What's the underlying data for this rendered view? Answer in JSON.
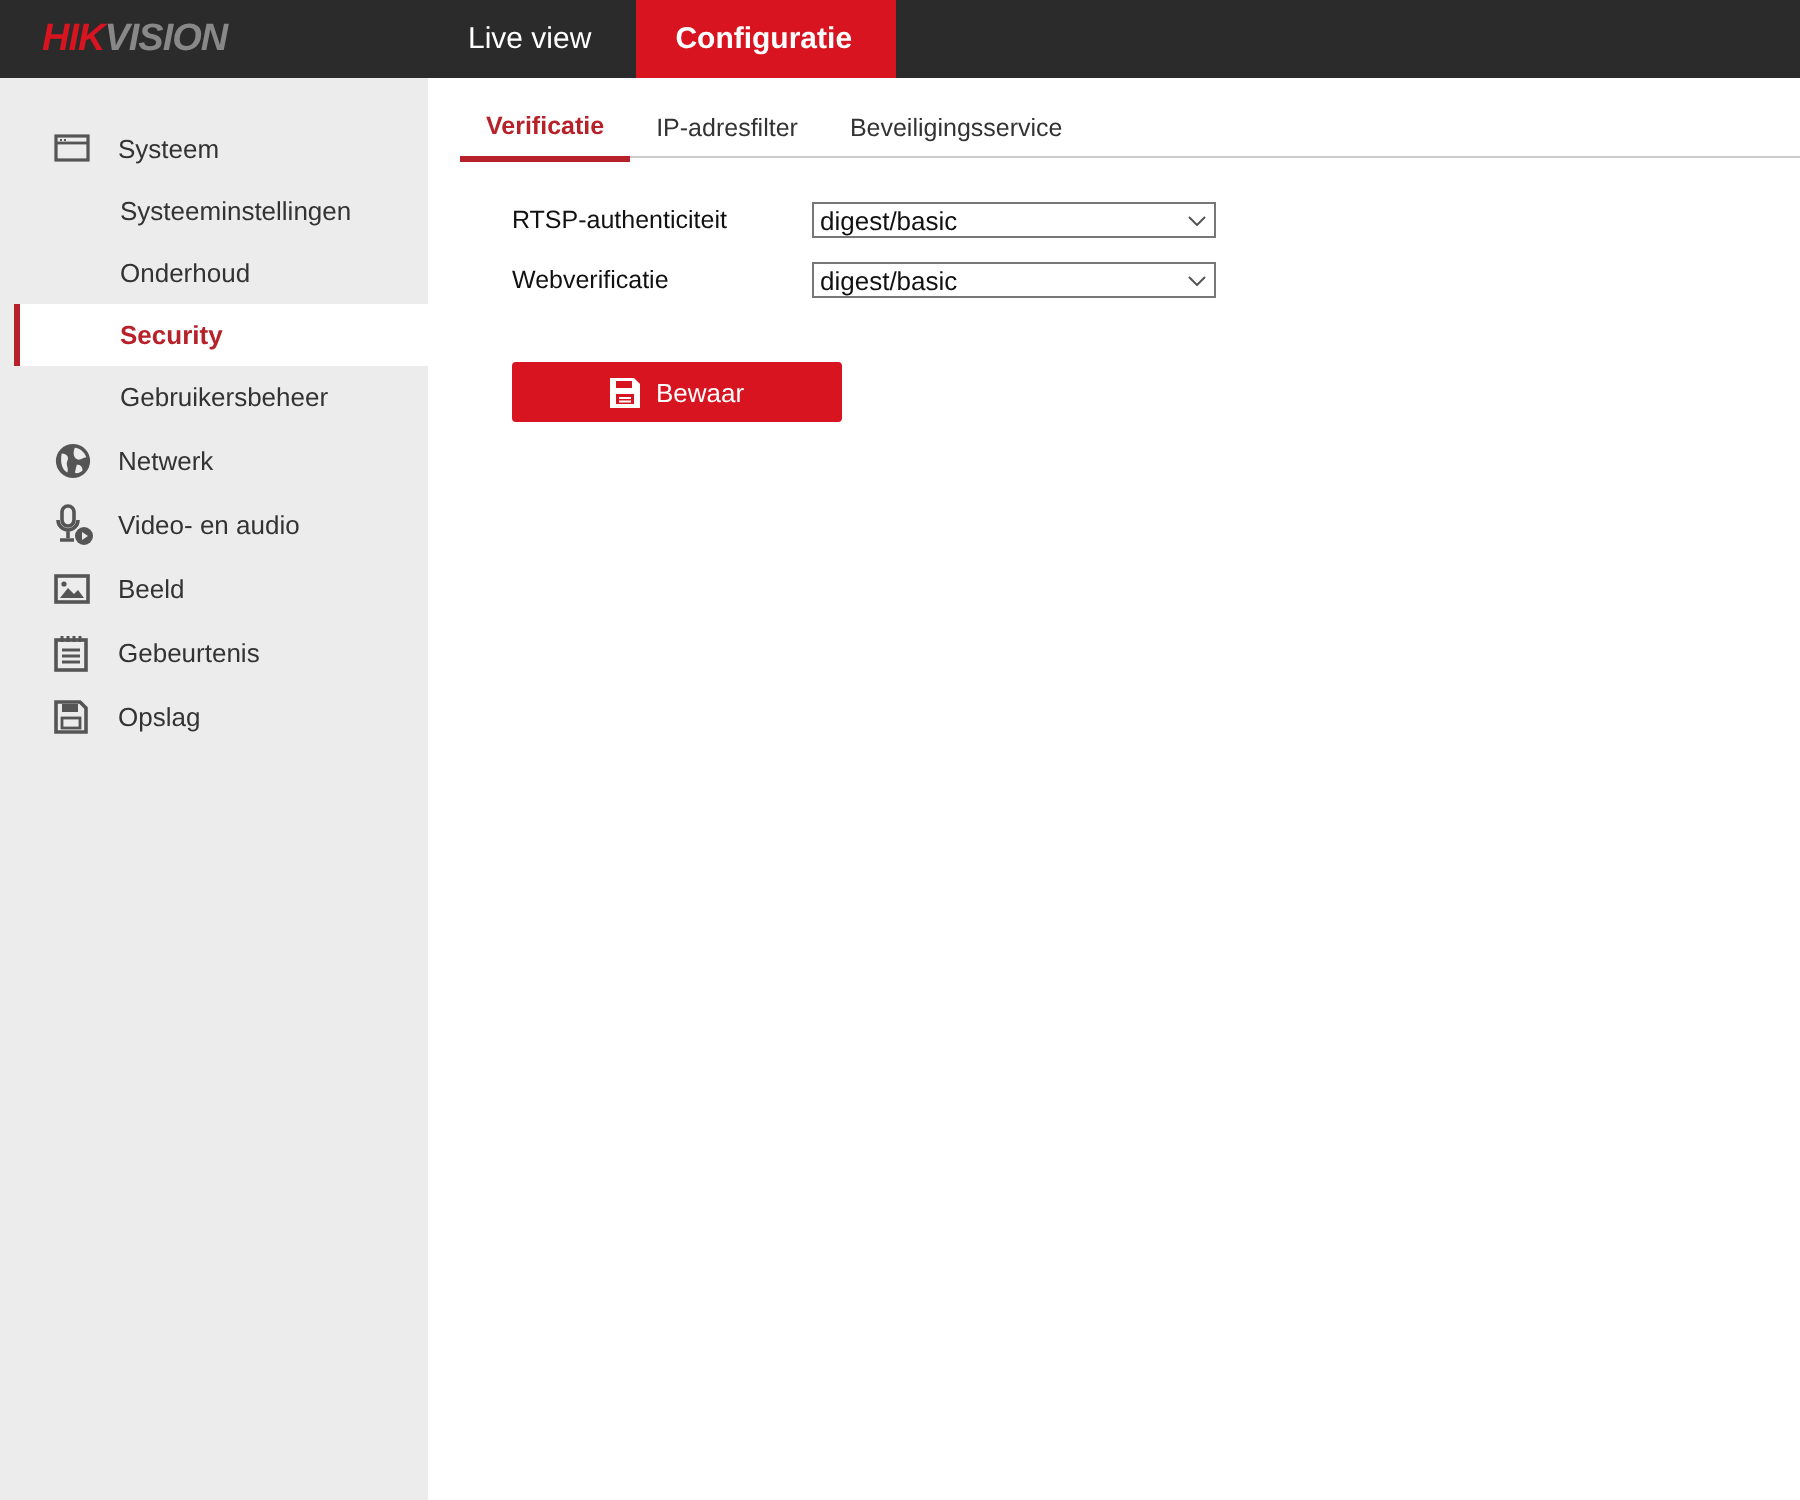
{
  "logo": {
    "accent": "HIK",
    "rest": "VISION"
  },
  "nav": [
    {
      "label": "Live view",
      "selected": false
    },
    {
      "label": "Configuratie",
      "selected": true
    }
  ],
  "sidebar": {
    "groups": [
      {
        "label": "Systeem",
        "children": [
          {
            "label": "Systeeminstellingen",
            "selected": false
          },
          {
            "label": "Onderhoud",
            "selected": false
          },
          {
            "label": "Security",
            "selected": true
          },
          {
            "label": "Gebruikersbeheer",
            "selected": false
          }
        ]
      },
      {
        "label": "Netwerk"
      },
      {
        "label": "Video- en audio"
      },
      {
        "label": "Beeld"
      },
      {
        "label": "Gebeurtenis"
      },
      {
        "label": "Opslag"
      }
    ]
  },
  "tabs": [
    {
      "label": "Verificatie",
      "selected": true
    },
    {
      "label": "IP-adresfilter",
      "selected": false
    },
    {
      "label": "Beveiligingsservice",
      "selected": false
    }
  ],
  "form": [
    {
      "label": "RTSP-authenticiteit",
      "value": "digest/basic"
    },
    {
      "label": "Webverificatie",
      "value": "digest/basic"
    }
  ],
  "save_button": {
    "label": "Bewaar"
  }
}
